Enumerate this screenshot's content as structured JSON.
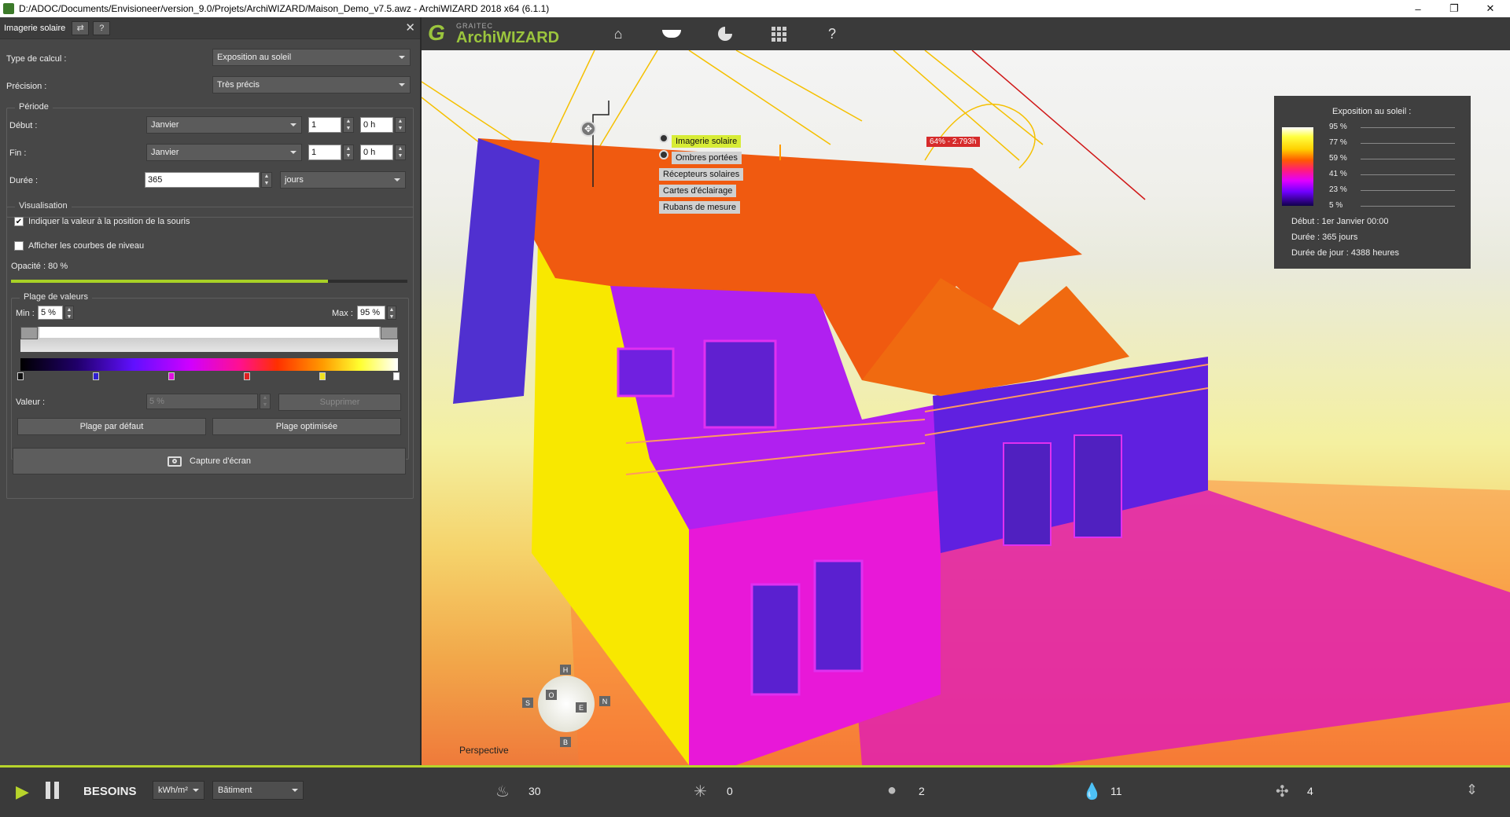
{
  "window": {
    "title": "D:/ADOC/Documents/Envisioneer/version_9.0/Projets/ArchiWIZARD/Maison_Demo_v7.5.awz  -  ArchiWIZARD 2018 x64 (6.1.1)",
    "minimize": "–",
    "restore": "❐",
    "close": "✕"
  },
  "panel": {
    "title": "Imagerie solaire",
    "help": "?",
    "close": "✕",
    "type_label": "Type de calcul :",
    "type_value": "Exposition au soleil",
    "precision_label": "Précision :",
    "precision_value": "Très précis",
    "periode_title": "Période",
    "debut_label": "Début :",
    "debut_month": "Janvier",
    "debut_day": "1",
    "debut_hour": "0 h",
    "fin_label": "Fin :",
    "fin_month": "Janvier",
    "fin_day": "1",
    "fin_hour": "0 h",
    "duree_label": "Durée :",
    "duree_value": "365",
    "duree_unit": "jours",
    "visu_title": "Visualisation",
    "chk1_label": "Indiquer la valeur à la position de la souris",
    "chk1_checked": true,
    "chk2_label": "Afficher les courbes de niveau",
    "chk2_checked": false,
    "opacite_label": "Opacité : 80 %",
    "opacity_fraction": 0.8,
    "plage_title": "Plage de valeurs",
    "min_label": "Min :",
    "min_value": "5 %",
    "max_label": "Max :",
    "max_value": "95 %",
    "valeur_label": "Valeur :",
    "valeur_value": "5 %",
    "supprimer": "Supprimer",
    "plage_defaut": "Plage par défaut",
    "plage_opt": "Plage optimisée",
    "capture": "Capture d'écran"
  },
  "toolbar": {
    "logo_small": "GRAITEC",
    "logo_big": "ArchiWIZARD",
    "icons": [
      "home-icon",
      "sun-lamp-icon",
      "pie-chart-icon",
      "grid-icon",
      "help-icon"
    ]
  },
  "viewport": {
    "menu": [
      "Imagerie solaire",
      "Ombres portées",
      "Récepteurs solaires",
      "Cartes d'éclairage",
      "Rubans de mesure"
    ],
    "tooltip": "64% - 2.793h",
    "perspective": "Perspective",
    "compass": {
      "h": "H",
      "s": "S",
      "o": "O",
      "e": "E",
      "n": "N",
      "b": "B"
    },
    "legend": {
      "title": "Exposition au soleil :",
      "ticks": [
        "95 %",
        "77 %",
        "59 %",
        "41 %",
        "23 %",
        "5 %"
      ],
      "debut": "Début : 1er Janvier 00:00",
      "duree": "Durée : 365 jours",
      "duree_jour": "Durée de jour : 4388 heures"
    }
  },
  "bottombar": {
    "besoins": "BESOINS",
    "unit": "kWh/m²",
    "scope": "Bâtiment",
    "heating": "30",
    "cooling": "0",
    "lighting": "2",
    "water": "11",
    "ventilation": "4"
  }
}
